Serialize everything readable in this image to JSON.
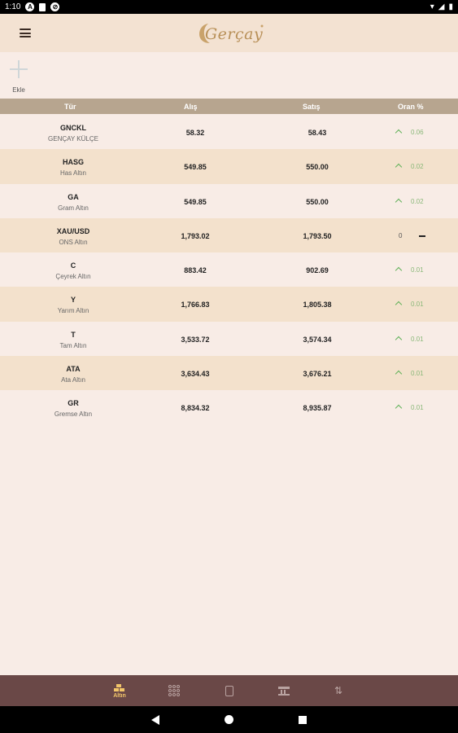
{
  "status_bar": {
    "time": "1:10",
    "icon_a": "A"
  },
  "header": {
    "logo_text": "Gerçay"
  },
  "add": {
    "label": "Ekle"
  },
  "table": {
    "columns": [
      "Tür",
      "Alış",
      "Satış",
      "Oran %"
    ],
    "rows": [
      {
        "code": "GNCKL",
        "name": "GENÇAY KÜLÇE",
        "buy": "58.32",
        "sell": "58.43",
        "rate": "0.06",
        "trend": "up"
      },
      {
        "code": "HASG",
        "name": "Has Altın",
        "buy": "549.85",
        "sell": "550.00",
        "rate": "0.02",
        "trend": "up"
      },
      {
        "code": "GA",
        "name": "Gram Altın",
        "buy": "549.85",
        "sell": "550.00",
        "rate": "0.02",
        "trend": "up"
      },
      {
        "code": "XAU/USD",
        "name": "ONS Altın",
        "buy": "1,793.02",
        "sell": "1,793.50",
        "rate": "0",
        "trend": "flat"
      },
      {
        "code": "C",
        "name": "Çeyrek Altın",
        "buy": "883.42",
        "sell": "902.69",
        "rate": "0.01",
        "trend": "up"
      },
      {
        "code": "Y",
        "name": "Yarım Altın",
        "buy": "1,766.83",
        "sell": "1,805.38",
        "rate": "0.01",
        "trend": "up"
      },
      {
        "code": "T",
        "name": "Tam Altın",
        "buy": "3,533.72",
        "sell": "3,574.34",
        "rate": "0.01",
        "trend": "up"
      },
      {
        "code": "ATA",
        "name": "Ata Altın",
        "buy": "3,634.43",
        "sell": "3,676.21",
        "rate": "0.01",
        "trend": "up"
      },
      {
        "code": "GR",
        "name": "Gremse Altın",
        "buy": "8,834.32",
        "sell": "8,935.87",
        "rate": "0.01",
        "trend": "up"
      }
    ]
  },
  "bottom_nav": {
    "items": [
      {
        "label": "Altın",
        "icon": "gold-bars-icon"
      },
      {
        "label": "",
        "icon": "currency-grid-icon"
      },
      {
        "label": "",
        "icon": "calculator-icon"
      },
      {
        "label": "",
        "icon": "bank-icon"
      },
      {
        "label": "",
        "icon": "swap-icon"
      }
    ]
  },
  "colors": {
    "background": "#f8ece6",
    "header": "#f3e2d2",
    "table_header": "#b7a58f",
    "row_alt": "#f3e1cc",
    "bottom_nav": "#6a4847",
    "accent_gold": "#f2c66a",
    "rate_up": "#62b25a"
  }
}
